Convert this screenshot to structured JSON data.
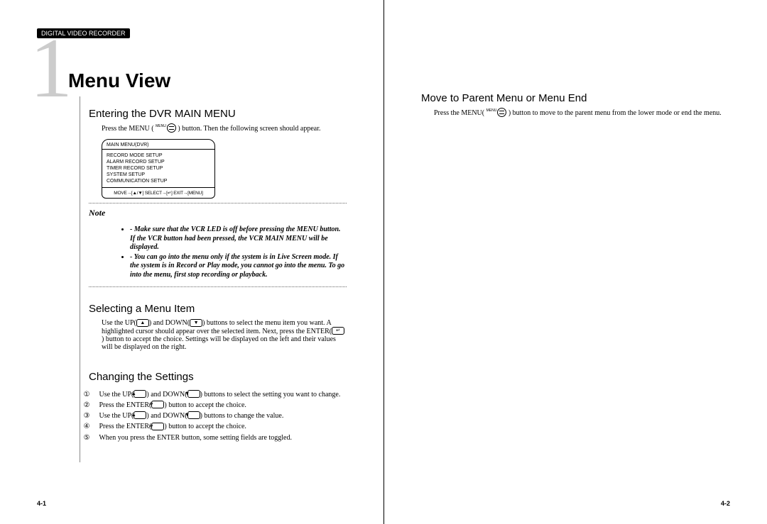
{
  "header": {
    "tag": "DIGITAL VIDEO RECORDER"
  },
  "chapter": {
    "number": "1",
    "title": "Menu View"
  },
  "left": {
    "s1": {
      "h": "Entering the DVR MAIN MENU",
      "body_pre": "Press the MENU (",
      "body_post": ") button. Then the following screen should appear.",
      "crt": {
        "title": "MAIN MENU(DVR)",
        "items": [
          "RECORD MODE SETUP",
          "ALARM RECORD SETUP",
          "TIMER RECORD SETUP",
          "SYSTEM SETUP",
          "COMMUNICATION SETUP"
        ],
        "footer": "MOVE→[▲/▼] SELECT→[↵] EXIT→[MENU]"
      },
      "note_label": "Note",
      "notes": [
        "Make sure that the VCR LED is off before pressing the MENU button. If the VCR button had been pressed, the VCR MAIN MENU will be displayed.",
        "You can go into the menu only if the system is in Live Screen mode. If the system is in Record or Play mode, you cannot go into the menu. To go into the menu, first stop recording or playback."
      ]
    },
    "s2": {
      "h": "Selecting a Menu Item",
      "body": {
        "a": "Use the UP(",
        "b": ") and DOWN(",
        "c": ") buttons to select the menu item you want. A highlighted cursor should appear over the selected item. Next, press the ENTER(",
        "d": ") button to accept the choice. Settings will be displayed on the left and their values will be displayed on the right."
      }
    },
    "s3": {
      "h": "Changing the Settings",
      "steps": [
        {
          "n": "①",
          "a": "Use the UP(",
          "b": ") and DOWN(",
          "c": ") buttons to select the setting you want to change."
        },
        {
          "n": "②",
          "a": "Press the ENTER(",
          "b": ") button to accept the choice."
        },
        {
          "n": "③",
          "a": "Use the UP(",
          "b": ") and DOWN(",
          "c": ") buttons to change the value."
        },
        {
          "n": "④",
          "a": "Press the ENTER(",
          "b": ") button to accept the choice."
        },
        {
          "n": "⑤",
          "a": "When you press the ENTER button, some setting fields are toggled."
        }
      ]
    },
    "pagenum": "4-1"
  },
  "right": {
    "s1": {
      "h": "Move to Parent Menu or Menu End",
      "body_pre": "Press the MENU(",
      "body_post": ") button to move to the parent menu from the lower mode or end the menu."
    },
    "pagenum": "4-2"
  },
  "glyph": {
    "up": "▲",
    "down": "▼",
    "enter": "↵"
  }
}
